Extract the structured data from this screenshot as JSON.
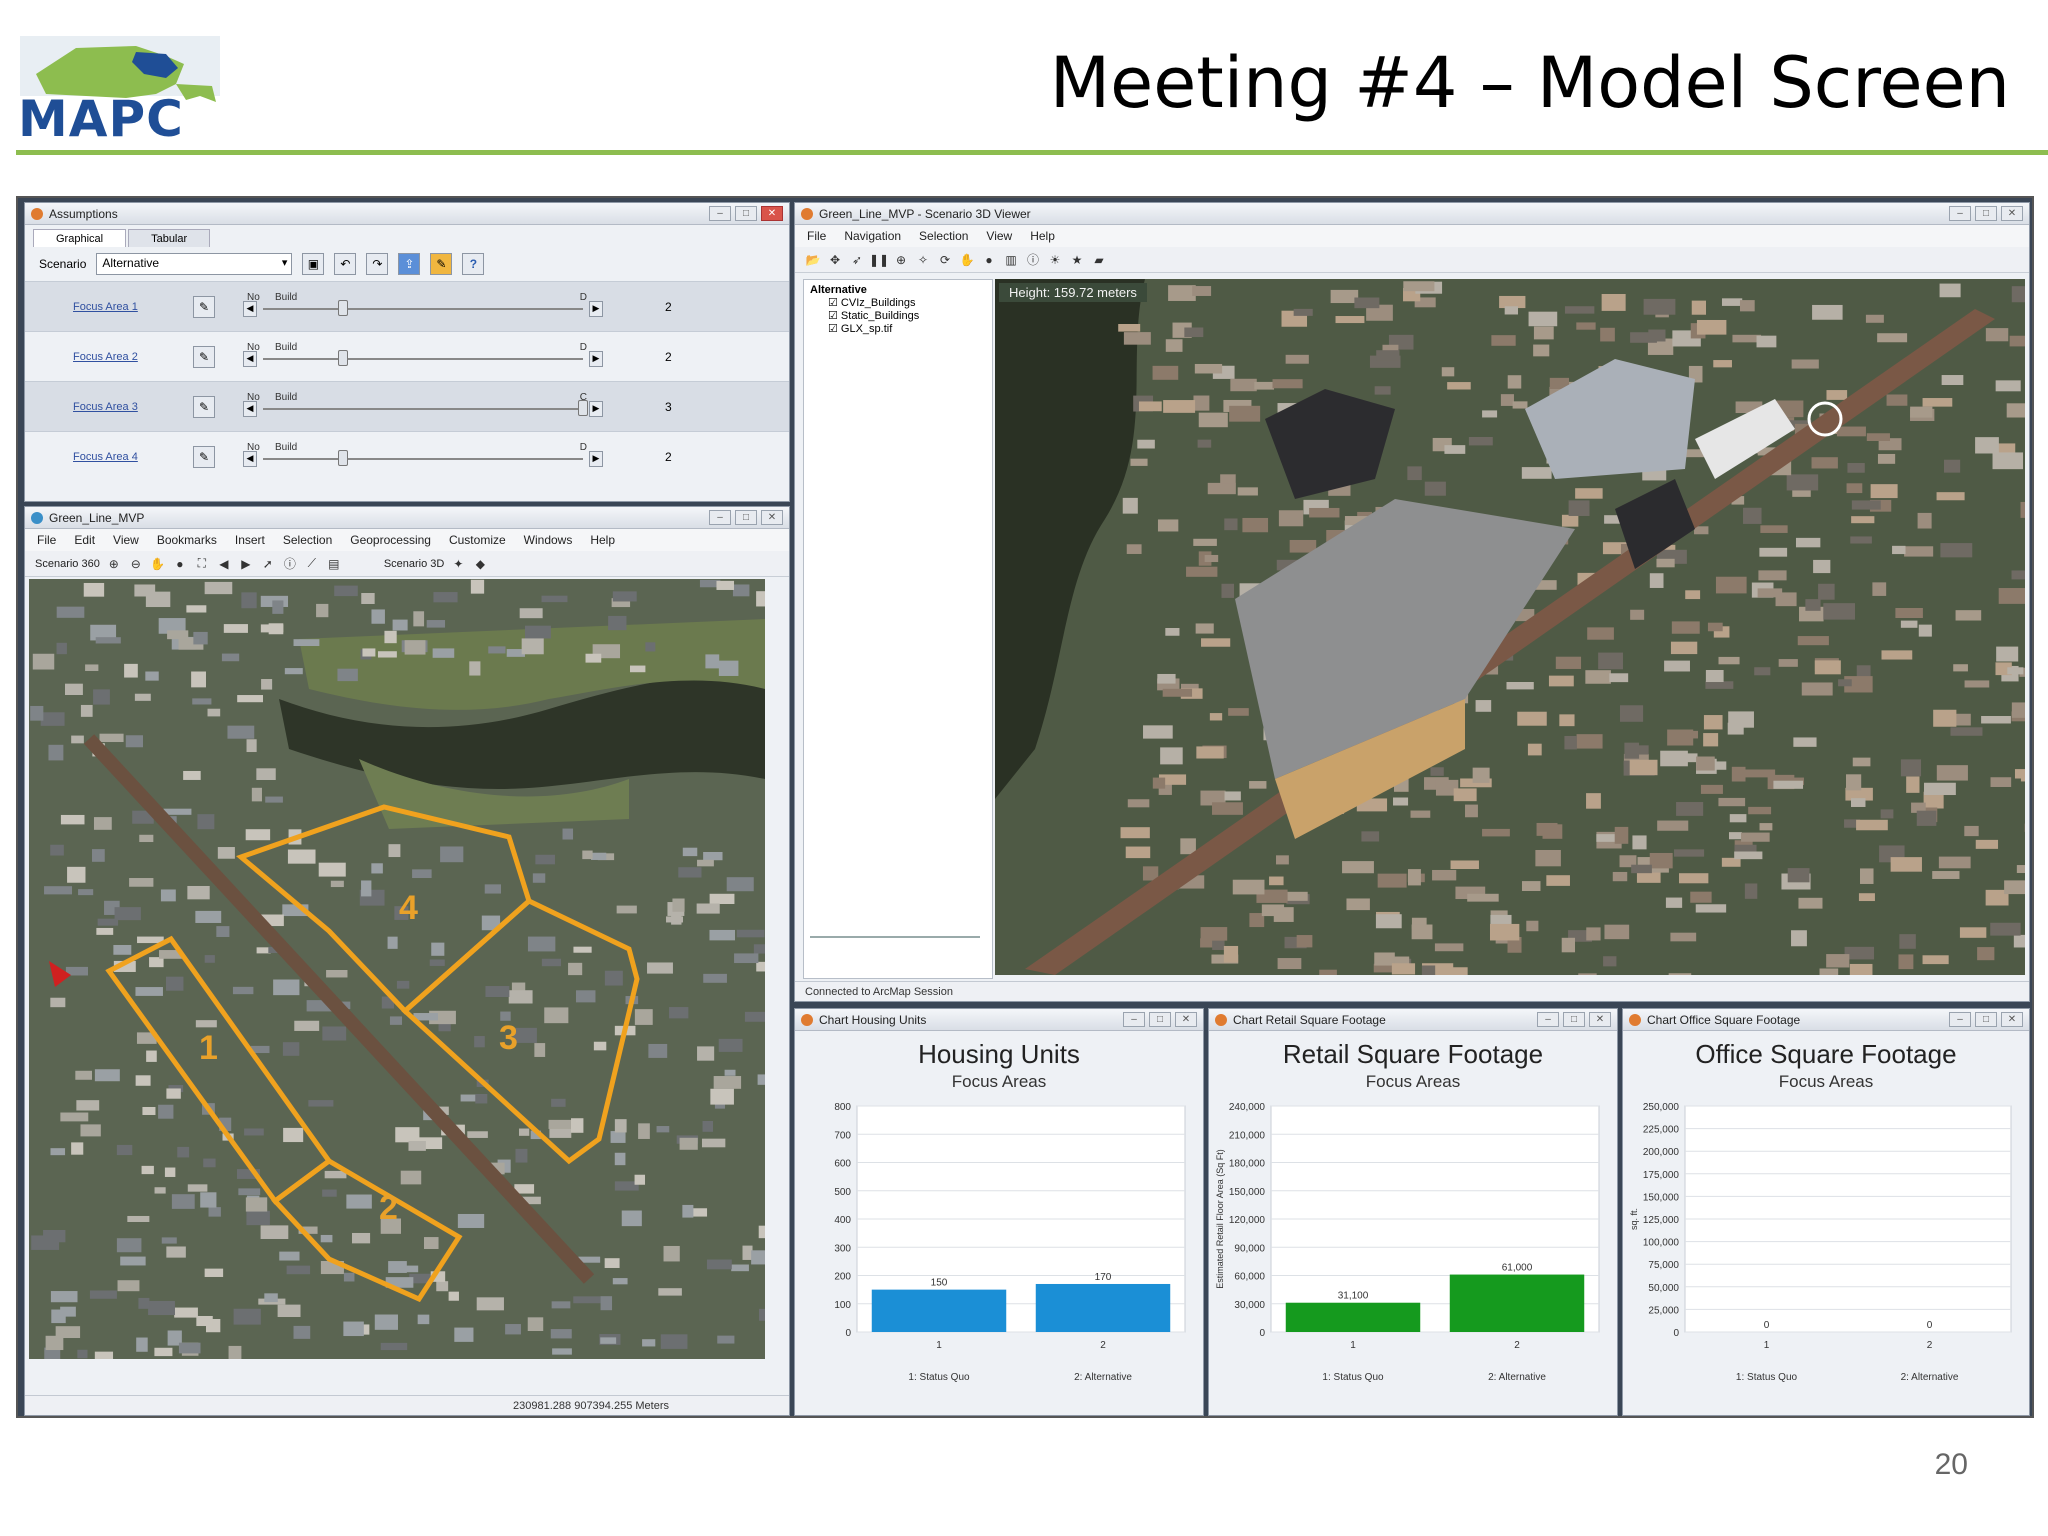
{
  "slide": {
    "title": "Meeting #4 – Model Screen",
    "logo_text": "MAPC",
    "page_number": "20"
  },
  "assumptions": {
    "title": "Assumptions",
    "tabs": [
      "Graphical",
      "Tabular"
    ],
    "scenario_label": "Scenario",
    "scenario_value": "Alternative",
    "rows": [
      {
        "label": "Focus Area 1",
        "left": "No",
        "mid": "Build",
        "right": "D",
        "value": "2",
        "level": 0.25
      },
      {
        "label": "Focus Area 2",
        "left": "No",
        "mid": "Build",
        "right": "D",
        "value": "2",
        "level": 0.25
      },
      {
        "label": "Focus Area 3",
        "left": "No",
        "mid": "Build",
        "right": "C",
        "value": "3",
        "level": 1.0
      },
      {
        "label": "Focus Area 4",
        "left": "No",
        "mid": "Build",
        "right": "D",
        "value": "2",
        "level": 0.25
      }
    ]
  },
  "map2d": {
    "title": "Green_Line_MVP",
    "menu": [
      "File",
      "Edit",
      "View",
      "Bookmarks",
      "Insert",
      "Selection",
      "Geoprocessing",
      "Customize",
      "Windows",
      "Help"
    ],
    "toolbar_scenario_label": "Scenario 360",
    "toolbar_scenario3d_label": "Scenario 3D",
    "coordinates": "230981.288  907394.255 Meters",
    "focus_labels": [
      "1",
      "2",
      "3",
      "4"
    ]
  },
  "viewer3d": {
    "title": "Green_Line_MVP - Scenario 3D Viewer",
    "menu": [
      "File",
      "Navigation",
      "Selection",
      "View",
      "Help"
    ],
    "toc_header": "Alternative",
    "layers": [
      "CVIz_Buildings",
      "Static_Buildings",
      "GLX_sp.tif"
    ],
    "height_readout": "Height:  159.72  meters",
    "status": "Connected to ArcMap Session"
  },
  "charts_windows": [
    {
      "window_title": "Chart Housing Units"
    },
    {
      "window_title": "Chart Retail Square Footage"
    },
    {
      "window_title": "Chart Office Square Footage"
    }
  ],
  "chart_data": [
    {
      "type": "bar",
      "title": "Housing Units",
      "subtitle": "Focus Areas",
      "ylabel": "",
      "categories": [
        "1",
        "2"
      ],
      "legend": [
        "1: Status Quo",
        "2: Alternative"
      ],
      "values": [
        150,
        170
      ],
      "data_labels": [
        "150",
        "170"
      ],
      "yticks": [
        "800",
        "700",
        "600",
        "500",
        "400",
        "300",
        "200",
        "100",
        "0"
      ],
      "ylim": [
        0,
        800
      ],
      "color": "#1b8fd6",
      "grid": true
    },
    {
      "type": "bar",
      "title": "Retail Square Footage",
      "subtitle": "Focus Areas",
      "ylabel": "Estimated Retail Floor Area (Sq Ft)",
      "categories": [
        "1",
        "2"
      ],
      "legend": [
        "1: Status Quo",
        "2: Alternative"
      ],
      "values": [
        31100,
        61000
      ],
      "data_labels": [
        "31,100",
        "61,000"
      ],
      "yticks": [
        "240,000",
        "210,000",
        "180,000",
        "150,000",
        "120,000",
        "90,000",
        "60,000",
        "30,000",
        "0"
      ],
      "ylim": [
        0,
        240000
      ],
      "color": "#159a1e",
      "grid": true
    },
    {
      "type": "bar",
      "title": "Office Square Footage",
      "subtitle": "Focus Areas",
      "ylabel": "sq. ft.",
      "categories": [
        "1",
        "2"
      ],
      "legend": [
        "1: Status Quo",
        "2: Alternative"
      ],
      "values": [
        0,
        0
      ],
      "data_labels": [
        "0",
        "0"
      ],
      "yticks": [
        "250,000",
        "225,000",
        "200,000",
        "175,000",
        "150,000",
        "125,000",
        "100,000",
        "75,000",
        "50,000",
        "25,000",
        "0"
      ],
      "ylim": [
        0,
        250000
      ],
      "color": "#1b8fd6",
      "grid": true
    }
  ]
}
